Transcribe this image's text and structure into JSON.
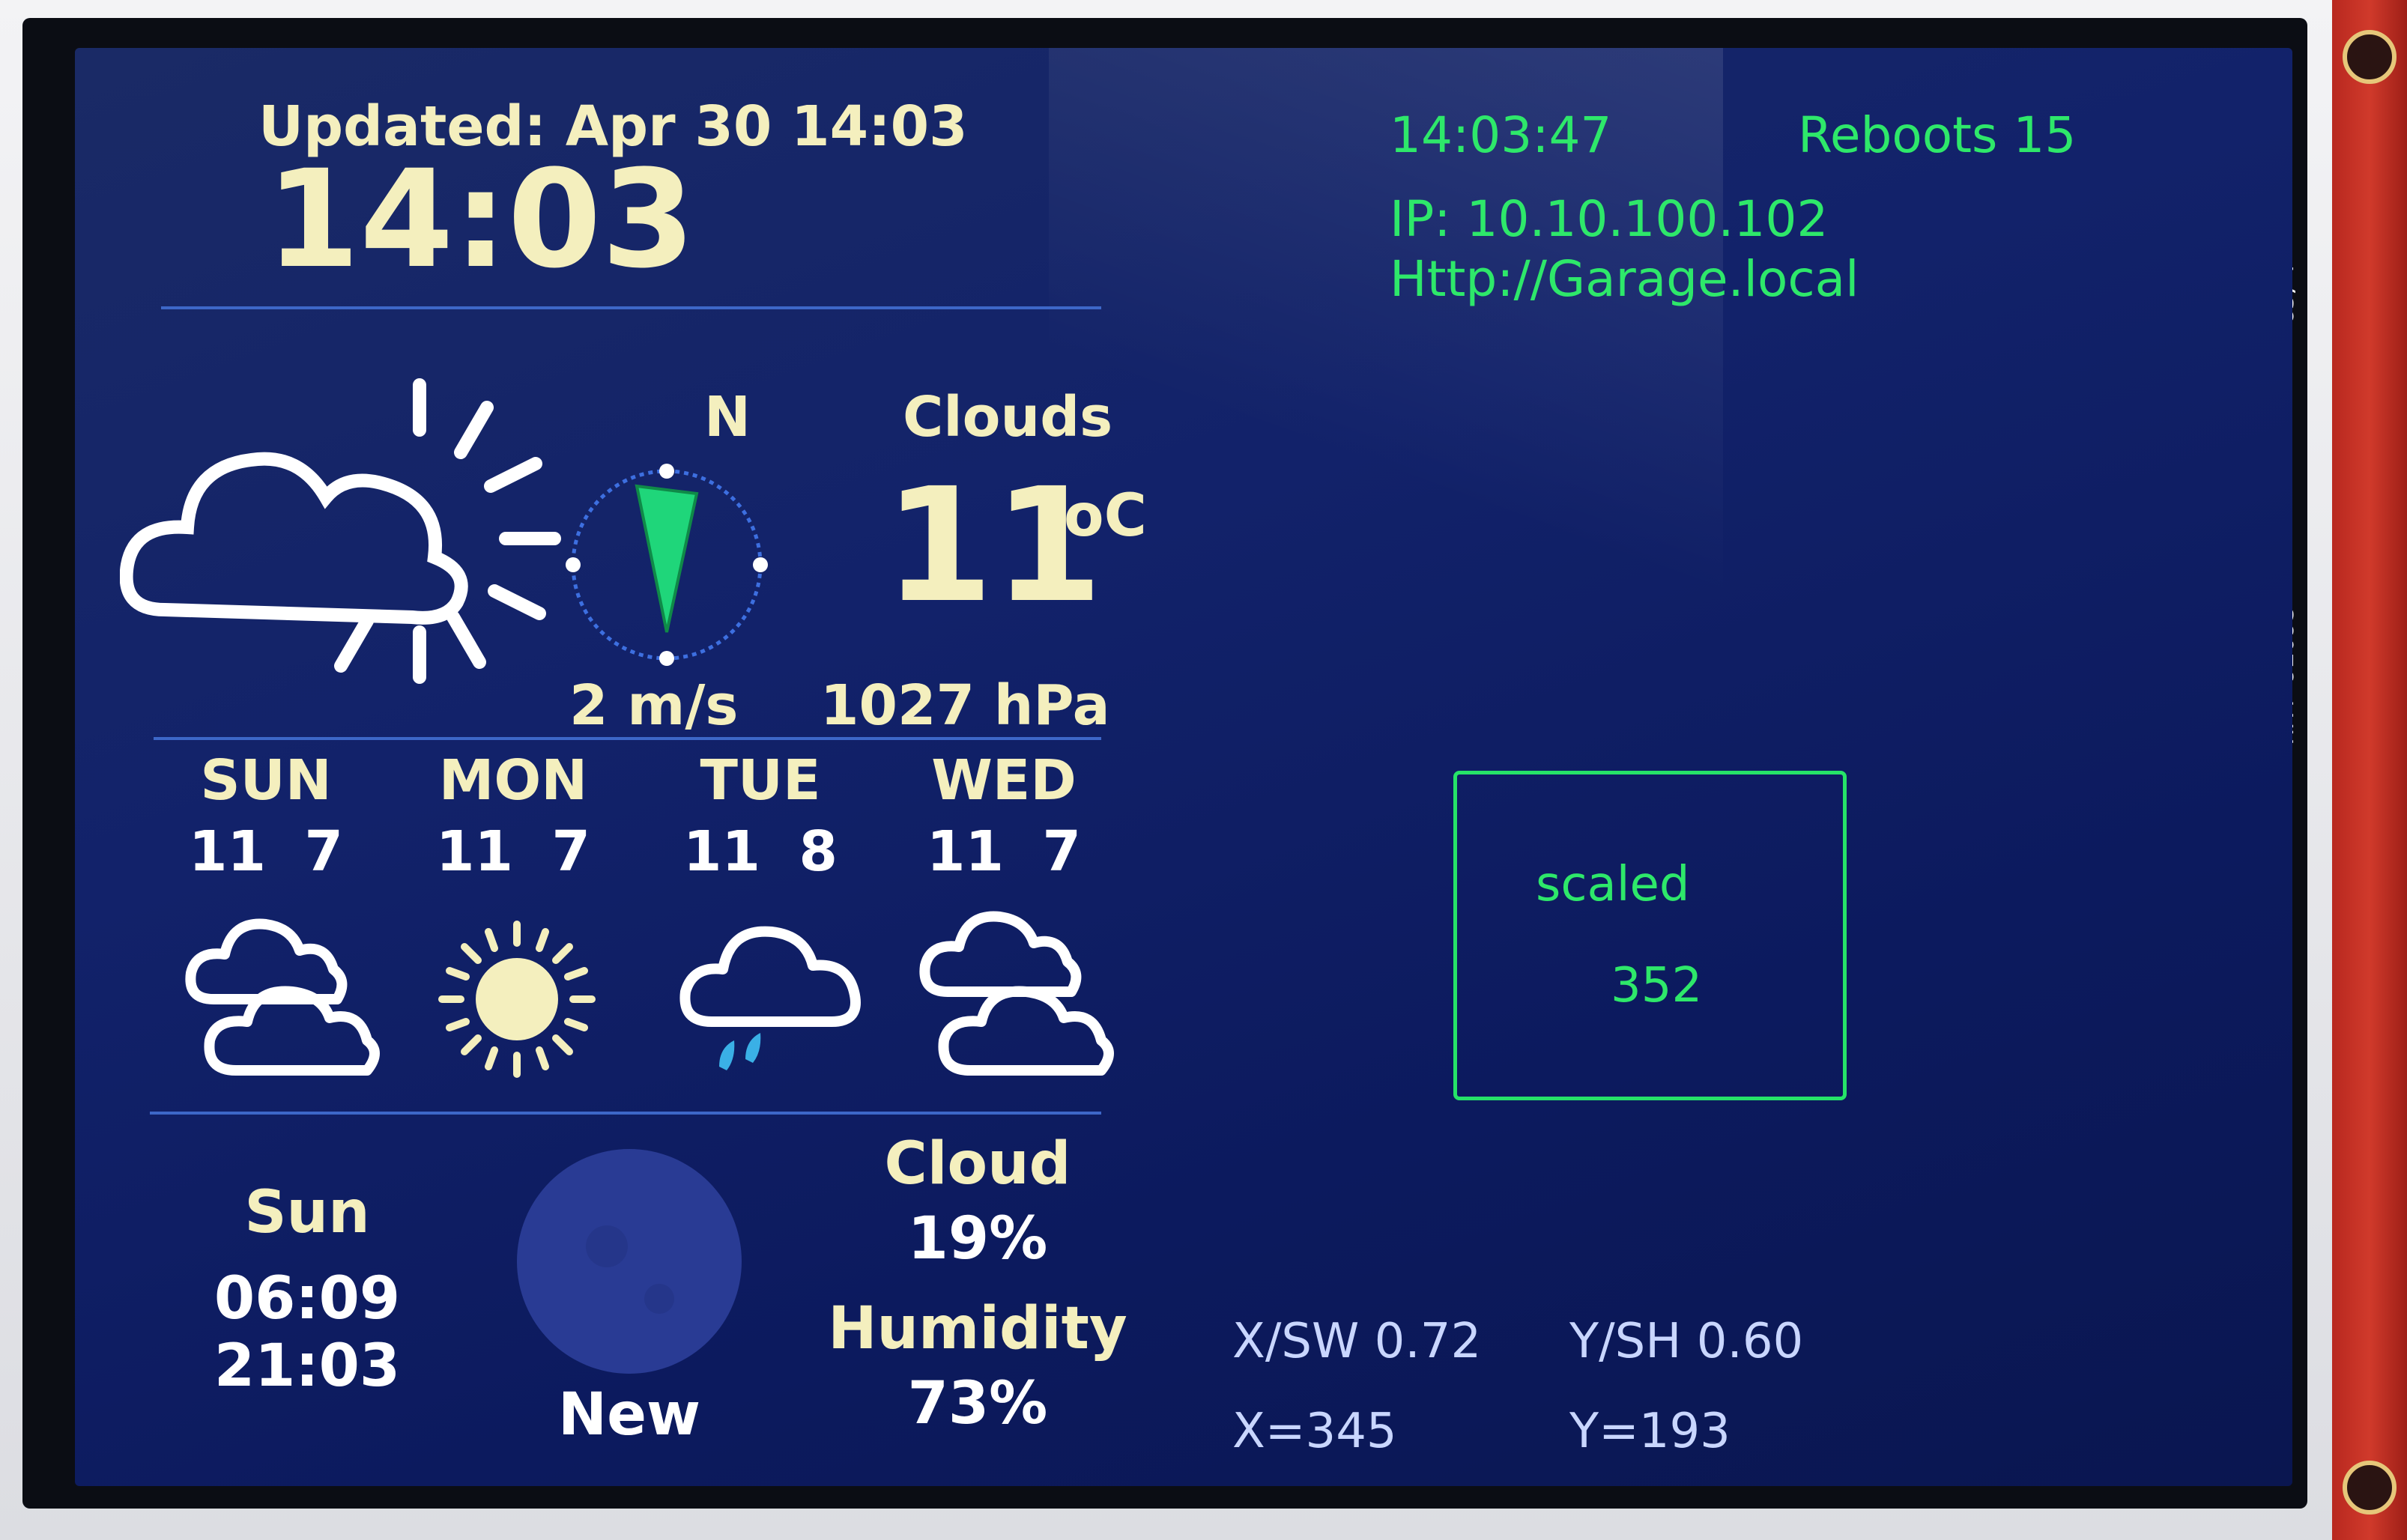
{
  "header": {
    "updated": "Updated: Apr 30 14:03",
    "time": "14:03",
    "clock": "14:03:47",
    "reboots": "Reboots 15",
    "ip": "IP: 10.10.100.102",
    "url": "Http://Garage.local"
  },
  "current": {
    "icon": "partly-cloudy-icon",
    "wind_dir": "N",
    "wind_speed": "2 m/s",
    "condition": "Clouds",
    "temp": "11",
    "temp_unit": "oC",
    "pressure": "1027 hPa"
  },
  "forecast": [
    {
      "day": "SUN",
      "temps": "11  7",
      "icon": "cloudy-icon"
    },
    {
      "day": "MON",
      "temps": "11  7",
      "icon": "sunny-icon"
    },
    {
      "day": "TUE",
      "temps": "11  8",
      "icon": "rain-icon"
    },
    {
      "day": "WED",
      "temps": "11  7",
      "icon": "cloudy-icon"
    }
  ],
  "footer": {
    "day": "Sun",
    "sunrise": "06:09",
    "sunset": "21:03",
    "moon_phase": "New",
    "cloud_label": "Cloud",
    "cloud_value": "19%",
    "humidity_label": "Humidity",
    "humidity_value": "73%"
  },
  "touch": {
    "box_label": "scaled",
    "box_value": "352",
    "xsw": "X/SW 0.72",
    "ysh": "Y/SH 0.60",
    "x": "X=345",
    "y": "Y=193"
  },
  "board": {
    "silk_top": "G5/4",
    "silk_bottom": "HR4  9209S"
  },
  "colors": {
    "screen_bg": "#12226a",
    "accent_green": "#2ee86a",
    "text_cream": "#f4efbe",
    "divider_blue": "#3d67c8"
  }
}
